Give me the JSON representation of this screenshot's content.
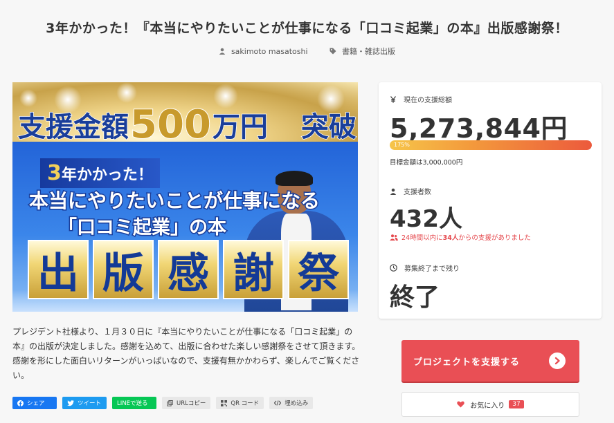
{
  "page": {
    "title": "3年かかった！『本当にやりたいことが仕事になる「口コミ起業」の本』出版感謝祭！",
    "author": "sakimoto masatoshi",
    "category": "書籍・雑誌出版"
  },
  "hero": {
    "line1_a": "支援金額",
    "line1_b": "500",
    "line1_c": "万円",
    "line1_d": "突破",
    "badge_num": "3",
    "badge_text": "年かかった！",
    "line3": "本当にやりたいことが仕事になる",
    "line4": "「口コミ起業」の本",
    "tiles": [
      "出",
      "版",
      "感",
      "謝",
      "祭"
    ]
  },
  "description": "プレジデント社様より、１月３０日に『本当にやりたいことが仕事になる「口コミ起業」の本』の出版が決定しました。感謝を込めて、出版に合わせた楽しい感謝祭をさせて頂きます。感謝を形にした面白いリターンがいっぱいなので、支援有無かかわらず、楽しんでご覧ください。",
  "share": {
    "facebook": "シェア",
    "twitter": "ツイート",
    "line": "LINEで送る",
    "url_copy": "URLコピー",
    "qr": "QR コード",
    "embed": "埋め込み"
  },
  "stats": {
    "funding_label": "現在の支援総額",
    "funding_amount": "5,273,844円",
    "progress_percent": 175,
    "progress_text": "175%",
    "goal_text": "目標金額は3,000,000円",
    "backers_label": "支援者数",
    "backers_count": "432人",
    "recent_prefix": "24時間以内に",
    "recent_count": "34人",
    "recent_suffix": "からの支援がありました",
    "remaining_label": "募集終了まで残り",
    "remaining_value": "終了"
  },
  "actions": {
    "support_button": "プロジェクトを支援する",
    "favorite_label": "お気に入り",
    "favorite_count": "37"
  },
  "colors": {
    "accent": "#e94f55",
    "facebook": "#1877f2",
    "twitter": "#1d9bf0",
    "line": "#06c755",
    "progress_start": "#f6c54a",
    "progress_end": "#ec5a3c"
  }
}
